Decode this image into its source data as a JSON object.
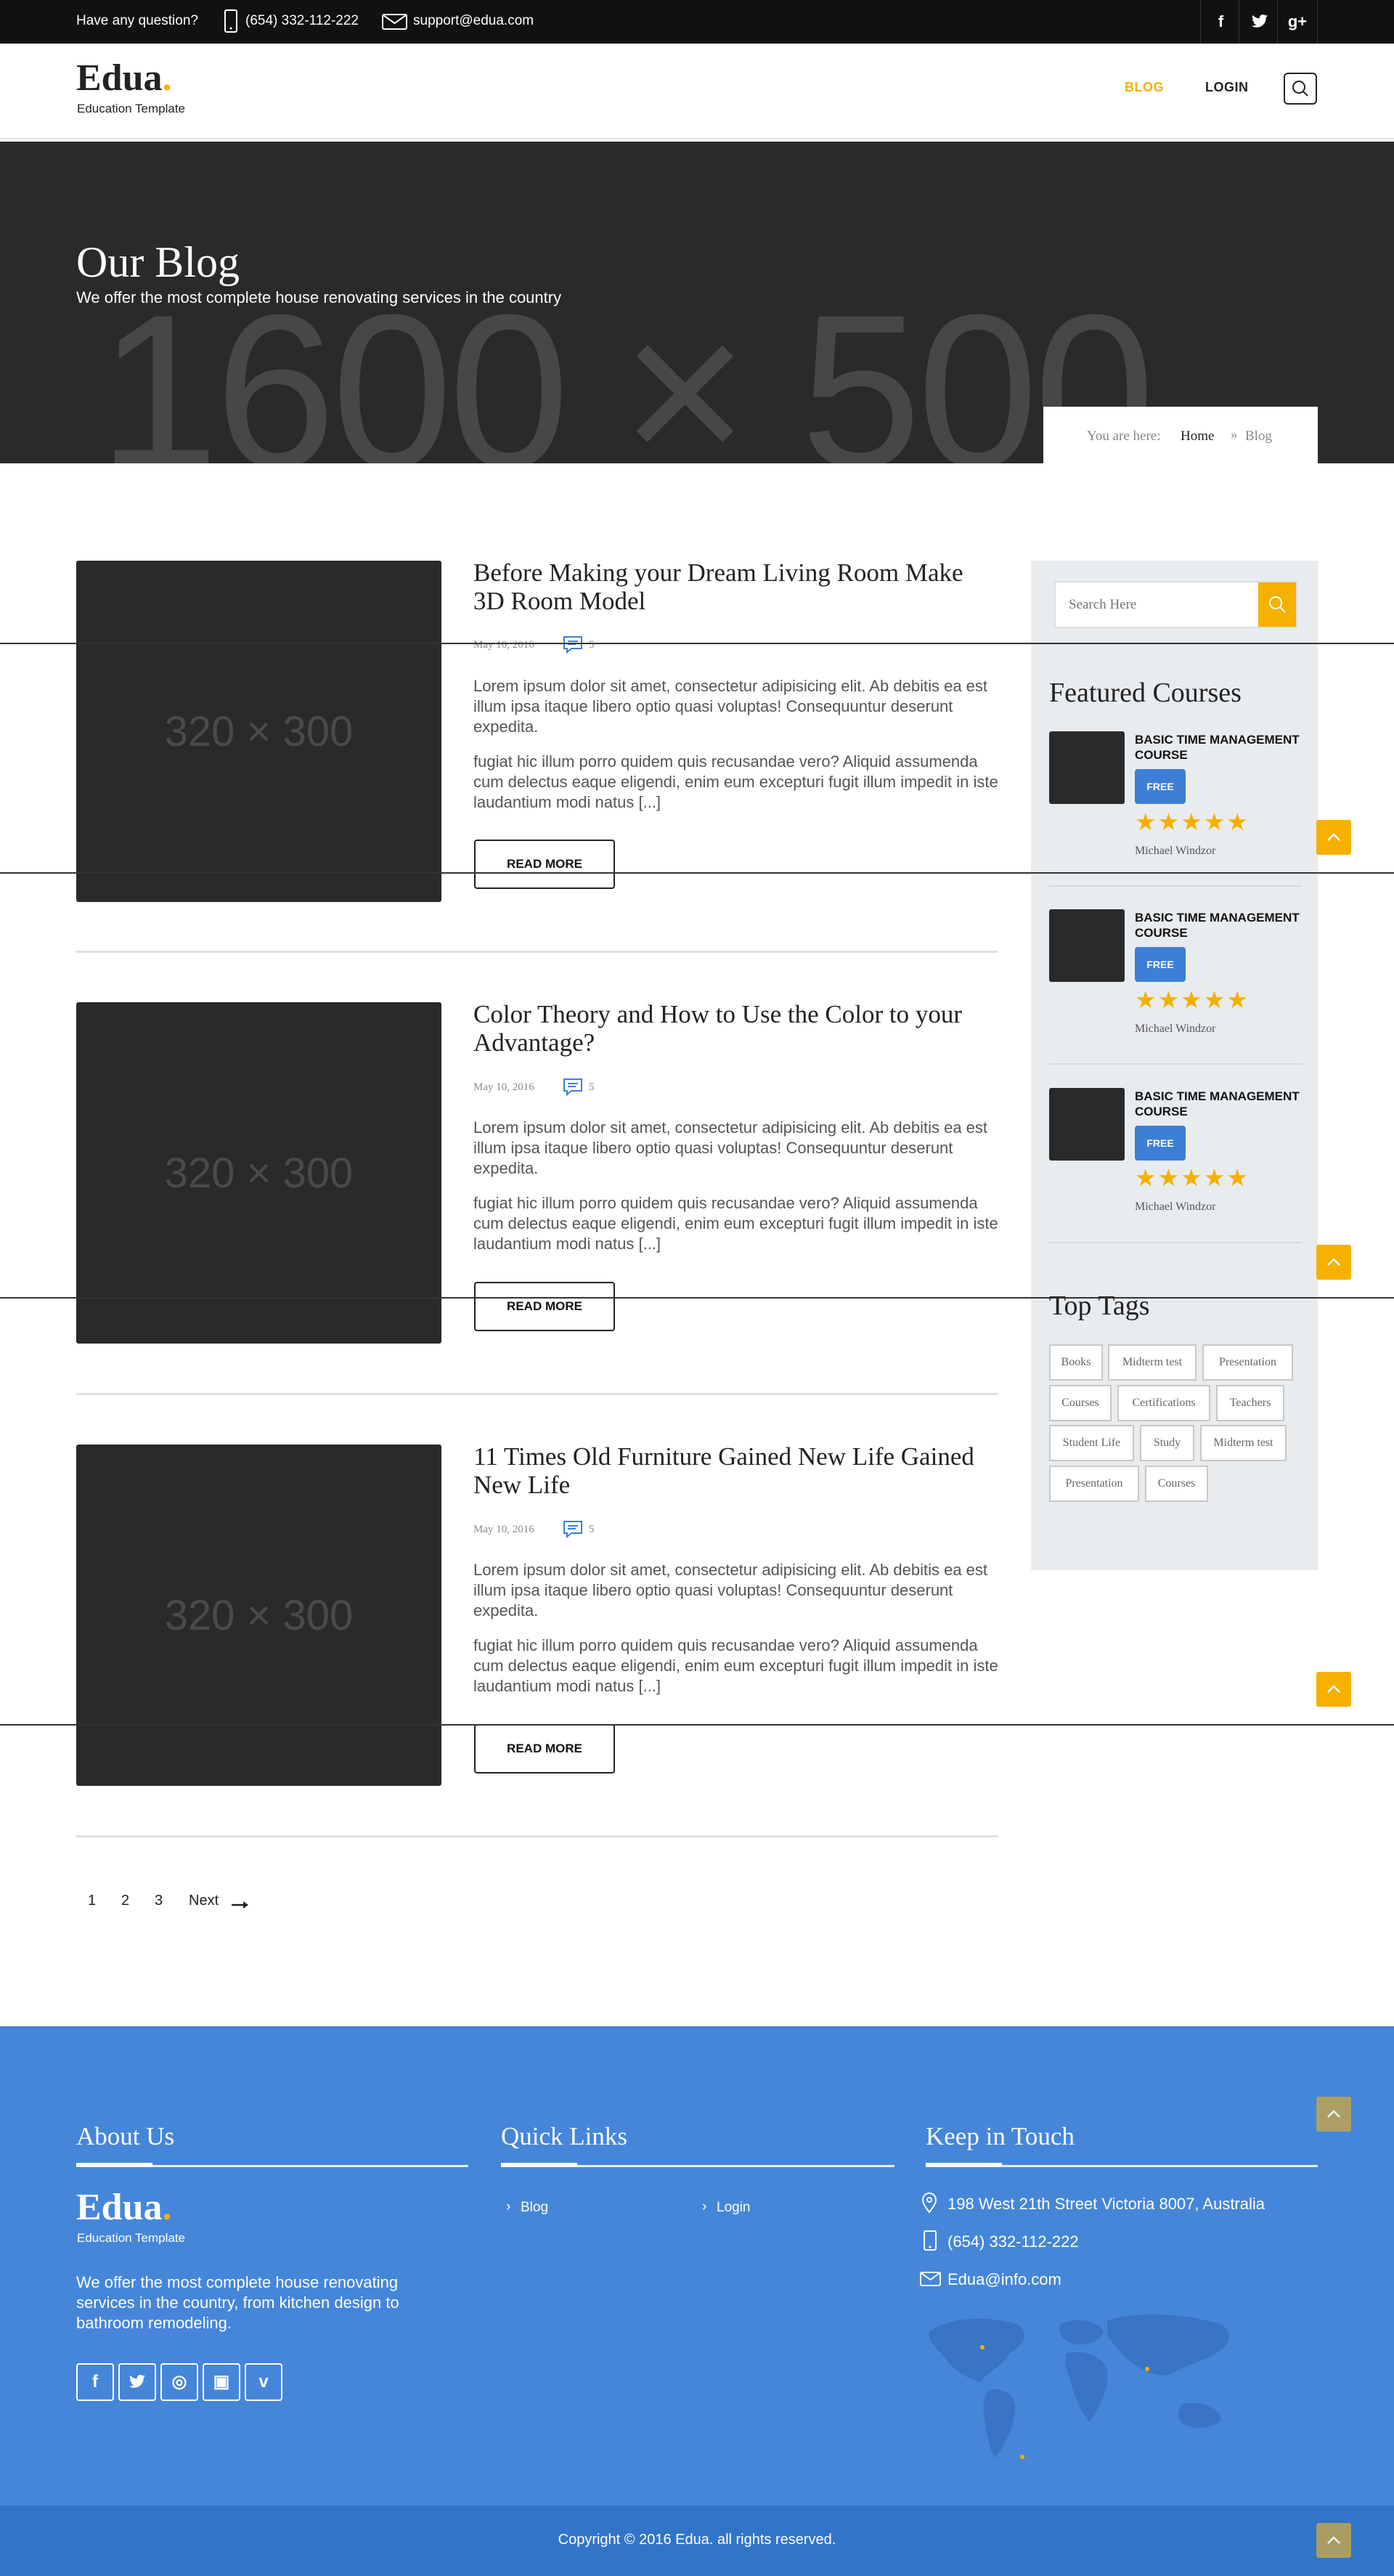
{
  "topbar": {
    "question": "Have any question?",
    "phone": "(654) 332-112-222",
    "email": "support@edua.com",
    "social": [
      "f",
      "t",
      "g+"
    ]
  },
  "header": {
    "logo": "Edua",
    "logo_dot": ".",
    "tagline": "Education Template",
    "nav": [
      "BLOG",
      "LOGIN"
    ]
  },
  "hero": {
    "title": "Our Blog",
    "subtitle": "We offer the most complete house renovating services in the country",
    "placeholder": "1600 × 500",
    "breadcrumb": {
      "prefix": "You are here:",
      "home": "Home",
      "current": "Blog"
    }
  },
  "posts": [
    {
      "thumb": "320 × 300",
      "title": "Before Making your Dream Living Room Make 3D Room Model",
      "date": "May 10, 2016",
      "comments": "5",
      "p1": "Lorem ipsum dolor sit amet, consectetur adipisicing elit. Ab debitis ea est illum ipsa itaque libero optio quasi voluptas! Consequuntur deserunt expedita.",
      "p2": "fugiat hic illum porro quidem quis recusandae vero? Aliquid assumenda cum delectus eaque eligendi, enim eum excepturi fugit illum impedit in iste laudantium modi natus [...]",
      "button": "READ MORE"
    },
    {
      "thumb": "320 × 300",
      "title": "Color Theory and How to Use the Color to your Advantage?",
      "date": "May 10, 2016",
      "comments": "5",
      "p1": "Lorem ipsum dolor sit amet, consectetur adipisicing elit. Ab debitis ea est illum ipsa itaque libero optio quasi voluptas! Consequuntur deserunt expedita.",
      "p2": "fugiat hic illum porro quidem quis recusandae vero? Aliquid assumenda cum delectus eaque eligendi, enim eum excepturi fugit illum impedit in iste laudantium modi natus [...]",
      "button": "READ MORE"
    },
    {
      "thumb": "320 × 300",
      "title": "11 Times Old Furniture Gained New Life Gained New Life",
      "date": "May 10, 2016",
      "comments": "5",
      "p1": "Lorem ipsum dolor sit amet, consectetur adipisicing elit. Ab debitis ea est illum ipsa itaque libero optio quasi voluptas! Consequuntur deserunt expedita.",
      "p2": "fugiat hic illum porro quidem quis recusandae vero? Aliquid assumenda cum delectus eaque eligendi, enim eum excepturi fugit illum impedit in iste laudantium modi natus [...]",
      "button": "READ MORE"
    }
  ],
  "sidebar": {
    "search_placeholder": "Search Here",
    "featured_title": "Featured Courses",
    "courses": [
      {
        "title": "BASIC TIME MANAGEMENT COURSE",
        "badge": "FREE",
        "stars": "★★★★★",
        "rating": 5,
        "author": "Michael Windzor"
      },
      {
        "title": "BASIC TIME MANAGEMENT COURSE",
        "badge": "FREE",
        "stars": "★★★★★",
        "rating": 5,
        "author": "Michael Windzor"
      },
      {
        "title": "BASIC TIME MANAGEMENT COURSE",
        "badge": "FREE",
        "stars": "★★★★★",
        "rating": 5,
        "author": "Michael Windzor"
      }
    ],
    "tags_title": "Top Tags",
    "tags": [
      "Books",
      "Midterm test",
      "Presentation",
      "Courses",
      "Certifications",
      "Teachers",
      "Student Life",
      "Study",
      "Midterm test",
      "Presentation",
      "Courses"
    ]
  },
  "pagination": {
    "pages": [
      "1",
      "2",
      "3"
    ],
    "next": "Next"
  },
  "footer": {
    "about_title": "About Us",
    "logo": "Edua",
    "logo_dot": ".",
    "tagline": "Education Template",
    "about_text": "We offer the most complete house renovating services in the country, from kitchen design to bathroom remodeling.",
    "social": [
      "f",
      "t",
      "◎",
      "▣",
      "v"
    ],
    "links_title": "Quick Links",
    "links": [
      "Blog",
      "Login"
    ],
    "touch_title": "Keep in Touch",
    "address": "198 West 21th Street Victoria 8007, Australia",
    "phone": "(654) 332-112-222",
    "email": "Edua@info.com",
    "copyright": "Copyright © 2016 Edua. all rights reserved."
  },
  "colors": {
    "accent": "#f5b000",
    "footer_blue": "#4586d9",
    "badge_blue": "#3d7fd6",
    "dark": "#2a2a2a"
  }
}
